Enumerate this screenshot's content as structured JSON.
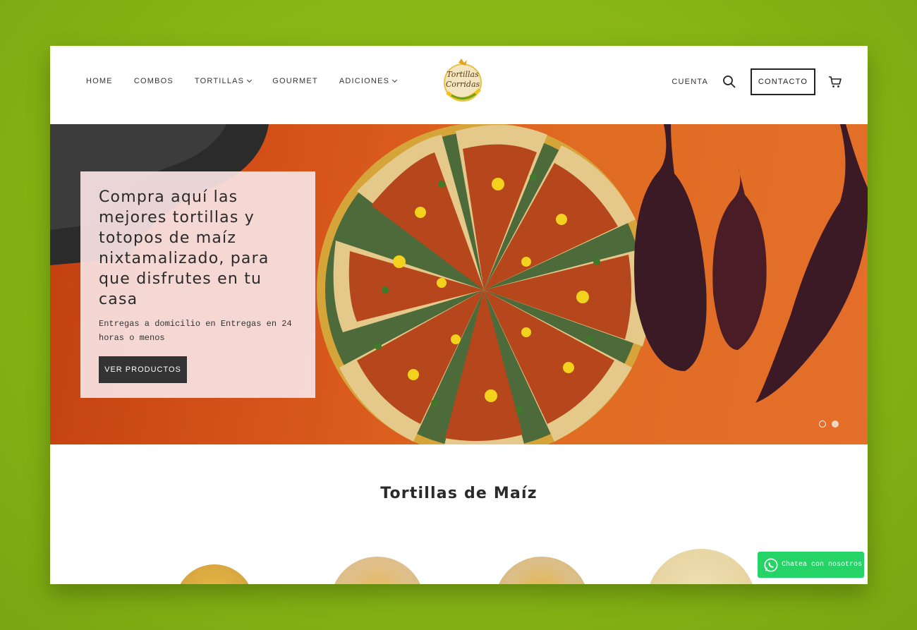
{
  "nav": {
    "items": [
      {
        "label": "HOME",
        "dropdown": false
      },
      {
        "label": "COMBOS",
        "dropdown": false
      },
      {
        "label": "TORTILLAS",
        "dropdown": true
      },
      {
        "label": "GOURMET",
        "dropdown": false
      },
      {
        "label": "ADICIONES",
        "dropdown": true
      }
    ],
    "account_label": "CUENTA",
    "contact_label": "CONTACTO"
  },
  "logo": {
    "line1": "Tortillas",
    "line2": "Corridas"
  },
  "hero": {
    "title": "Compra aquí las mejores tortillas y totopos de maíz nixtamalizado, para que disfrutes en tu casa",
    "subtitle": "Entregas a domicilio en Entregas en 24 horas o menos",
    "button_label": "VER PRODUCTOS",
    "slides": 2,
    "active_slide": 2
  },
  "section": {
    "title": "Tortillas de Maíz"
  },
  "whatsapp": {
    "label": "Chatea con nosotros"
  },
  "colors": {
    "accent": "#25d366",
    "hero_bg": "#d6531a",
    "card_bg": "#f8e2e2",
    "page_bg": "#86b515"
  }
}
